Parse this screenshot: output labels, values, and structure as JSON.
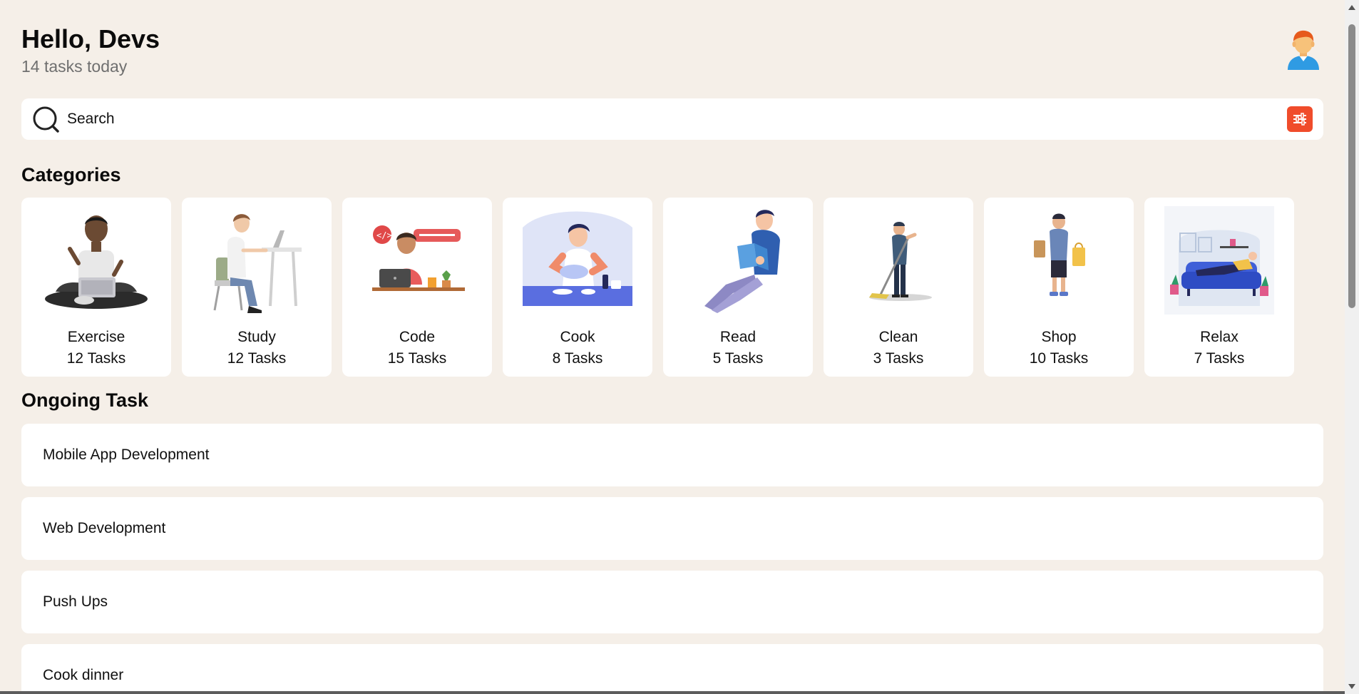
{
  "header": {
    "greeting": "Hello, Devs",
    "subtitle": "14 tasks today",
    "avatar_icon": "user-avatar-icon"
  },
  "search": {
    "placeholder": "Search",
    "search_icon": "search-icon",
    "filter_icon": "filter-sliders-icon",
    "accent_color": "#f04c2b"
  },
  "sections": {
    "categories_title": "Categories",
    "ongoing_title": "Ongoing Task"
  },
  "categories": [
    {
      "name": "Exercise",
      "count": "12 Tasks",
      "icon": "person-with-laptop-illustration"
    },
    {
      "name": "Study",
      "count": "12 Tasks",
      "icon": "person-studying-at-desk-illustration"
    },
    {
      "name": "Code",
      "count": "15 Tasks",
      "icon": "developer-coding-illustration"
    },
    {
      "name": "Cook",
      "count": "8 Tasks",
      "icon": "chef-cooking-illustration"
    },
    {
      "name": "Read",
      "count": "5 Tasks",
      "icon": "person-reading-book-illustration"
    },
    {
      "name": "Clean",
      "count": "3 Tasks",
      "icon": "person-mopping-illustration"
    },
    {
      "name": "Shop",
      "count": "10 Tasks",
      "icon": "person-with-shopping-bags-illustration"
    },
    {
      "name": "Relax",
      "count": "7 Tasks",
      "icon": "person-on-sofa-illustration"
    }
  ],
  "ongoing_tasks": [
    {
      "title": "Mobile App Development"
    },
    {
      "title": "Web Development"
    },
    {
      "title": "Push Ups"
    },
    {
      "title": "Cook dinner"
    }
  ],
  "colors": {
    "background": "#f5efe8",
    "card": "#ffffff",
    "accent": "#f04c2b"
  }
}
